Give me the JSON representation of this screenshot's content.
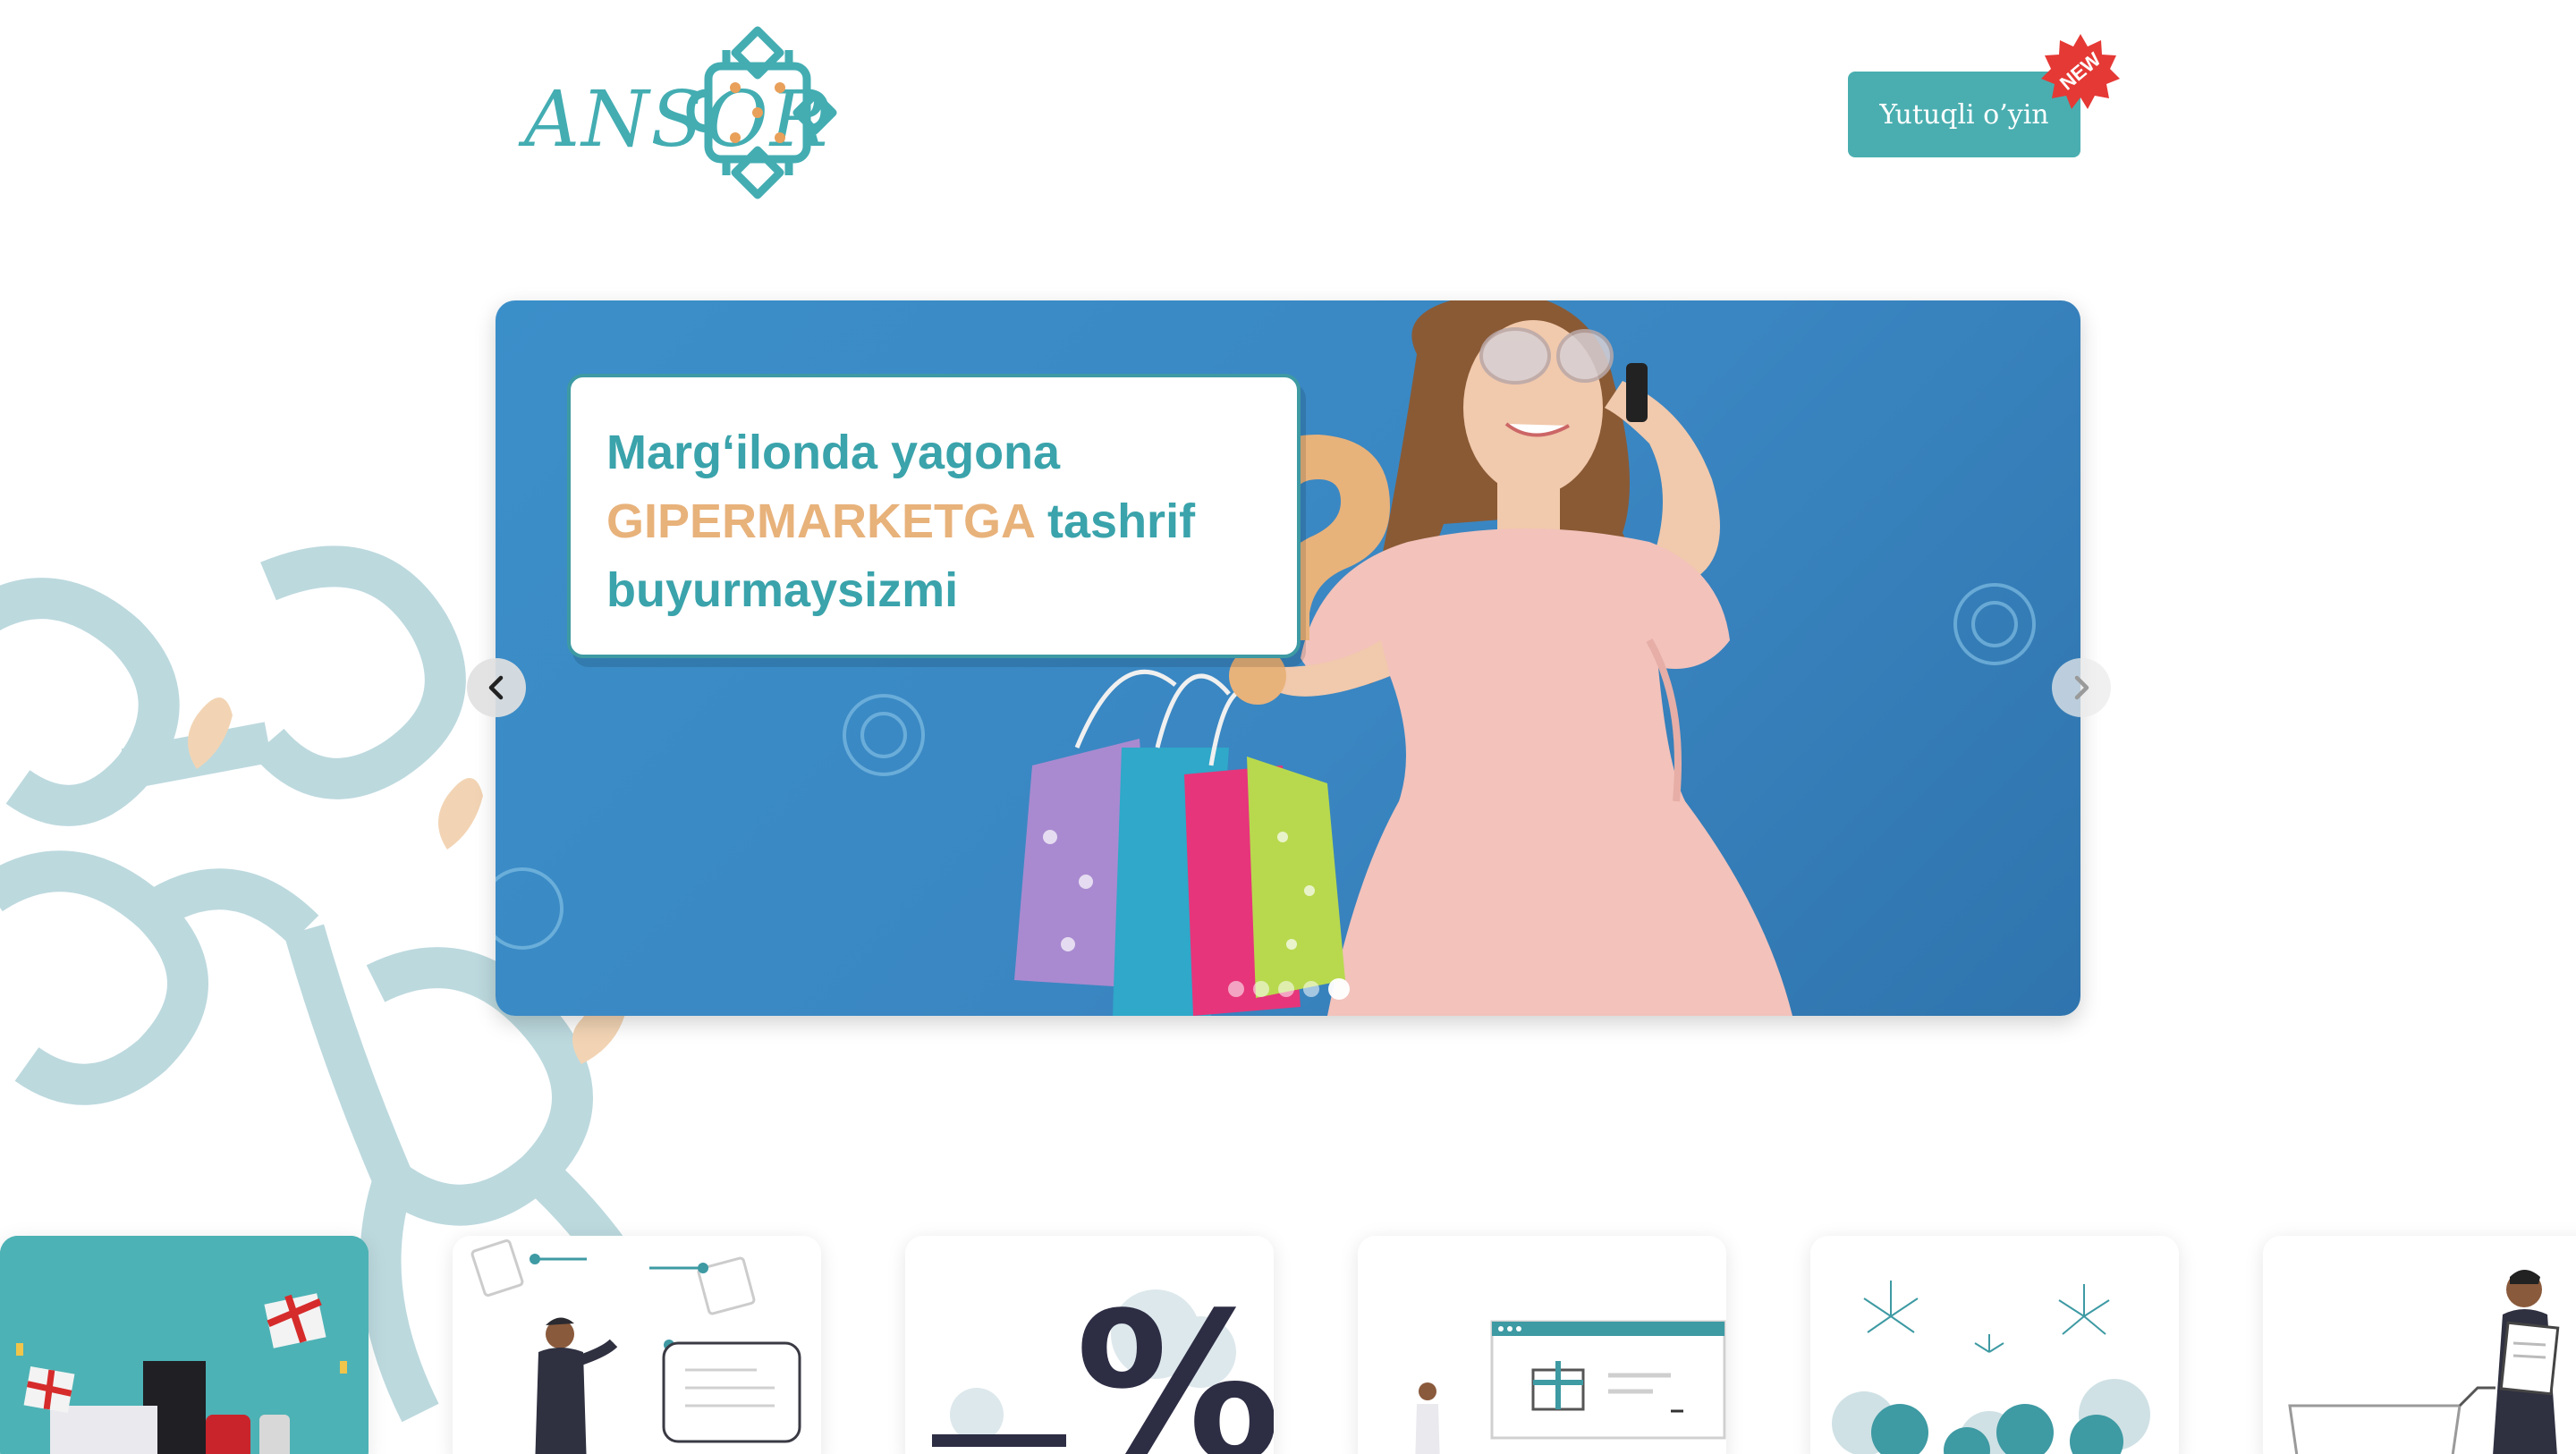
{
  "header": {
    "logo_text": "ANSOR",
    "game_button_label": "Yutuqli o’yin",
    "new_badge": "NEW"
  },
  "carousel": {
    "slide": {
      "line1": "Marg‘ilonda yagona",
      "line2_accent": "GIPERMARKETGA",
      "line2_rest": " tashrif",
      "line3": "buyurmaysizmi"
    },
    "dot_count": 5,
    "active_dot": 5
  },
  "colors": {
    "brand_teal": "#43adb2",
    "accent_peach": "#e8b27b",
    "slide_blue": "#3a86c2",
    "badge_red": "#e53935"
  },
  "icons": [
    "chevron-left-icon",
    "chevron-right-icon"
  ]
}
